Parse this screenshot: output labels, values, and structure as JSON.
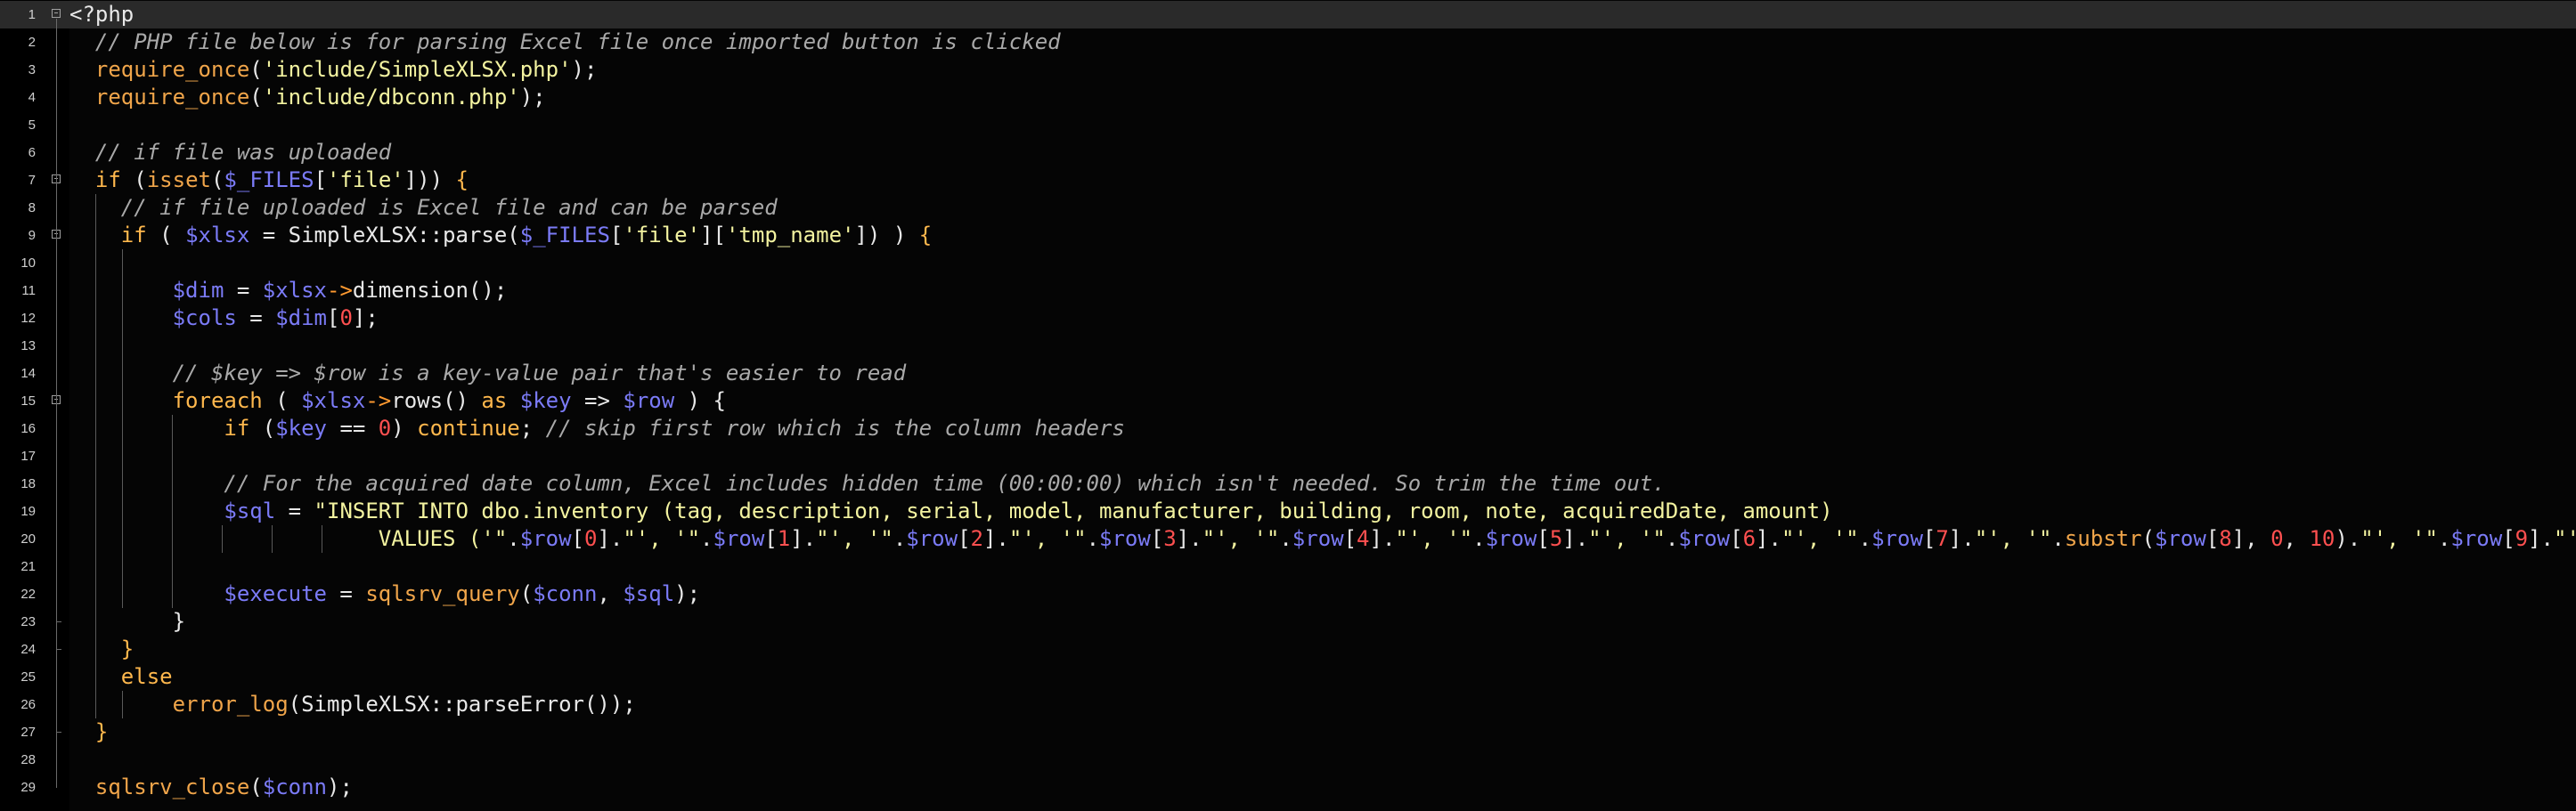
{
  "editor": {
    "language": "php",
    "current_line": 1,
    "colors": {
      "background": "#050505",
      "current_line": "#2a2a2a",
      "plain": "#e8e8e8",
      "comment": "#a9a9a9",
      "function": "#f0a54a",
      "keyword": "#ffb84d",
      "string": "#f3f3a0",
      "variable": "#7b7bf7",
      "number": "#ff5050",
      "operator": "#ff9a30"
    }
  },
  "lines": [
    {
      "n": "1",
      "fold": true,
      "tokens": [
        [
          "plain",
          "<?php"
        ]
      ]
    },
    {
      "n": "2",
      "tokens": [
        [
          "plain",
          "  "
        ],
        [
          "comment",
          "// PHP file below is for parsing Excel file once imported button is clicked"
        ]
      ]
    },
    {
      "n": "3",
      "tokens": [
        [
          "plain",
          "  "
        ],
        [
          "function",
          "require_once"
        ],
        [
          "plain",
          "("
        ],
        [
          "string",
          "'include/SimpleXLSX.php'"
        ],
        [
          "plain",
          ");"
        ]
      ]
    },
    {
      "n": "4",
      "tokens": [
        [
          "plain",
          "  "
        ],
        [
          "function",
          "require_once"
        ],
        [
          "plain",
          "("
        ],
        [
          "string",
          "'include/dbconn.php'"
        ],
        [
          "plain",
          ");"
        ]
      ]
    },
    {
      "n": "5",
      "tokens": []
    },
    {
      "n": "6",
      "tokens": [
        [
          "plain",
          "  "
        ],
        [
          "comment",
          "// if file was uploaded"
        ]
      ]
    },
    {
      "n": "7",
      "fold": true,
      "tokens": [
        [
          "plain",
          "  "
        ],
        [
          "keyword",
          "if"
        ],
        [
          "plain",
          " ("
        ],
        [
          "function",
          "isset"
        ],
        [
          "plain",
          "("
        ],
        [
          "variable",
          "$_FILES"
        ],
        [
          "plain",
          "["
        ],
        [
          "string",
          "'file'"
        ],
        [
          "plain",
          "])) "
        ],
        [
          "keyword",
          "{"
        ]
      ]
    },
    {
      "n": "8",
      "tokens": [
        [
          "plain",
          "    "
        ],
        [
          "comment",
          "// if file uploaded is Excel file and can be parsed"
        ]
      ]
    },
    {
      "n": "9",
      "fold": true,
      "tokens": [
        [
          "plain",
          "    "
        ],
        [
          "keyword",
          "if"
        ],
        [
          "plain",
          " ( "
        ],
        [
          "variable",
          "$xlsx"
        ],
        [
          "plain",
          " = SimpleXLSX::parse("
        ],
        [
          "variable",
          "$_FILES"
        ],
        [
          "plain",
          "["
        ],
        [
          "string",
          "'file'"
        ],
        [
          "plain",
          "]["
        ],
        [
          "string",
          "'tmp_name'"
        ],
        [
          "plain",
          "]) ) "
        ],
        [
          "keyword",
          "{"
        ]
      ]
    },
    {
      "n": "10",
      "tokens": []
    },
    {
      "n": "11",
      "tokens": [
        [
          "plain",
          "        "
        ],
        [
          "variable",
          "$dim"
        ],
        [
          "plain",
          " = "
        ],
        [
          "variable",
          "$xlsx"
        ],
        [
          "operator",
          "->"
        ],
        [
          "plain",
          "dimension();"
        ]
      ]
    },
    {
      "n": "12",
      "tokens": [
        [
          "plain",
          "        "
        ],
        [
          "variable",
          "$cols"
        ],
        [
          "plain",
          " = "
        ],
        [
          "variable",
          "$dim"
        ],
        [
          "plain",
          "["
        ],
        [
          "number",
          "0"
        ],
        [
          "plain",
          "];"
        ]
      ]
    },
    {
      "n": "13",
      "tokens": []
    },
    {
      "n": "14",
      "tokens": [
        [
          "plain",
          "        "
        ],
        [
          "comment",
          "// $key => $row is a key-value pair that's easier to read"
        ]
      ]
    },
    {
      "n": "15",
      "fold": true,
      "tokens": [
        [
          "plain",
          "        "
        ],
        [
          "keyword",
          "foreach"
        ],
        [
          "plain",
          " ( "
        ],
        [
          "variable",
          "$xlsx"
        ],
        [
          "operator",
          "->"
        ],
        [
          "plain",
          "rows() "
        ],
        [
          "keyword",
          "as"
        ],
        [
          "plain",
          " "
        ],
        [
          "variable",
          "$key"
        ],
        [
          "plain",
          " => "
        ],
        [
          "variable",
          "$row"
        ],
        [
          "plain",
          " ) {"
        ]
      ]
    },
    {
      "n": "16",
      "tokens": [
        [
          "plain",
          "            "
        ],
        [
          "keyword",
          "if"
        ],
        [
          "plain",
          " ("
        ],
        [
          "variable",
          "$key"
        ],
        [
          "plain",
          " == "
        ],
        [
          "number",
          "0"
        ],
        [
          "plain",
          ") "
        ],
        [
          "keyword",
          "continue"
        ],
        [
          "plain",
          "; "
        ],
        [
          "comment",
          "// skip first row which is the column headers"
        ]
      ]
    },
    {
      "n": "17",
      "tokens": []
    },
    {
      "n": "18",
      "tokens": [
        [
          "plain",
          "            "
        ],
        [
          "comment",
          "// For the acquired date column, Excel includes hidden time (00:00:00) which isn't needed. So trim the time out."
        ]
      ]
    },
    {
      "n": "19",
      "tokens": [
        [
          "plain",
          "            "
        ],
        [
          "variable",
          "$sql"
        ],
        [
          "plain",
          " = "
        ],
        [
          "string",
          "\"INSERT INTO dbo.inventory (tag, description, serial, model, manufacturer, building, room, note, acquiredDate, amount)"
        ]
      ]
    },
    {
      "n": "20",
      "tokens": [
        [
          "plain",
          "                        "
        ],
        [
          "string",
          "VALUES ('\""
        ],
        [
          "plain",
          "."
        ],
        [
          "variable",
          "$row"
        ],
        [
          "plain",
          "["
        ],
        [
          "number",
          "0"
        ],
        [
          "plain",
          "]."
        ],
        [
          "string",
          "\"', '\""
        ],
        [
          "plain",
          "."
        ],
        [
          "variable",
          "$row"
        ],
        [
          "plain",
          "["
        ],
        [
          "number",
          "1"
        ],
        [
          "plain",
          "]."
        ],
        [
          "string",
          "\"', '\""
        ],
        [
          "plain",
          "."
        ],
        [
          "variable",
          "$row"
        ],
        [
          "plain",
          "["
        ],
        [
          "number",
          "2"
        ],
        [
          "plain",
          "]."
        ],
        [
          "string",
          "\"', '\""
        ],
        [
          "plain",
          "."
        ],
        [
          "variable",
          "$row"
        ],
        [
          "plain",
          "["
        ],
        [
          "number",
          "3"
        ],
        [
          "plain",
          "]."
        ],
        [
          "string",
          "\"', '\""
        ],
        [
          "plain",
          "."
        ],
        [
          "variable",
          "$row"
        ],
        [
          "plain",
          "["
        ],
        [
          "number",
          "4"
        ],
        [
          "plain",
          "]."
        ],
        [
          "string",
          "\"', '\""
        ],
        [
          "plain",
          "."
        ],
        [
          "variable",
          "$row"
        ],
        [
          "plain",
          "["
        ],
        [
          "number",
          "5"
        ],
        [
          "plain",
          "]."
        ],
        [
          "string",
          "\"', '\""
        ],
        [
          "plain",
          "."
        ],
        [
          "variable",
          "$row"
        ],
        [
          "plain",
          "["
        ],
        [
          "number",
          "6"
        ],
        [
          "plain",
          "]."
        ],
        [
          "string",
          "\"', '\""
        ],
        [
          "plain",
          "."
        ],
        [
          "variable",
          "$row"
        ],
        [
          "plain",
          "["
        ],
        [
          "number",
          "7"
        ],
        [
          "plain",
          "]."
        ],
        [
          "string",
          "\"', '\""
        ],
        [
          "plain",
          "."
        ],
        [
          "function",
          "substr"
        ],
        [
          "plain",
          "("
        ],
        [
          "variable",
          "$row"
        ],
        [
          "plain",
          "["
        ],
        [
          "number",
          "8"
        ],
        [
          "plain",
          "], "
        ],
        [
          "number",
          "0"
        ],
        [
          "plain",
          ", "
        ],
        [
          "number",
          "10"
        ],
        [
          "plain",
          ")."
        ],
        [
          "string",
          "\"', '\""
        ],
        [
          "plain",
          "."
        ],
        [
          "variable",
          "$row"
        ],
        [
          "plain",
          "["
        ],
        [
          "number",
          "9"
        ],
        [
          "plain",
          "]."
        ],
        [
          "string",
          "\"')\""
        ],
        [
          "plain",
          ";"
        ]
      ]
    },
    {
      "n": "21",
      "tokens": []
    },
    {
      "n": "22",
      "tokens": [
        [
          "plain",
          "            "
        ],
        [
          "variable",
          "$execute"
        ],
        [
          "plain",
          " = "
        ],
        [
          "function",
          "sqlsrv_query"
        ],
        [
          "plain",
          "("
        ],
        [
          "variable",
          "$conn"
        ],
        [
          "plain",
          ", "
        ],
        [
          "variable",
          "$sql"
        ],
        [
          "plain",
          ");"
        ]
      ]
    },
    {
      "n": "23",
      "tokens": [
        [
          "plain",
          "        }"
        ]
      ]
    },
    {
      "n": "24",
      "tokens": [
        [
          "plain",
          "    "
        ],
        [
          "keyword",
          "}"
        ]
      ]
    },
    {
      "n": "25",
      "tokens": [
        [
          "plain",
          "    "
        ],
        [
          "keyword",
          "else"
        ]
      ]
    },
    {
      "n": "26",
      "tokens": [
        [
          "plain",
          "        "
        ],
        [
          "function",
          "error_log"
        ],
        [
          "plain",
          "(SimpleXLSX::parseError());"
        ]
      ]
    },
    {
      "n": "27",
      "tokens": [
        [
          "plain",
          "  "
        ],
        [
          "keyword",
          "}"
        ]
      ]
    },
    {
      "n": "28",
      "tokens": []
    },
    {
      "n": "29",
      "tokens": [
        [
          "plain",
          "  "
        ],
        [
          "function",
          "sqlsrv_close"
        ],
        [
          "plain",
          "("
        ],
        [
          "variable",
          "$conn"
        ],
        [
          "plain",
          ");"
        ]
      ]
    }
  ]
}
